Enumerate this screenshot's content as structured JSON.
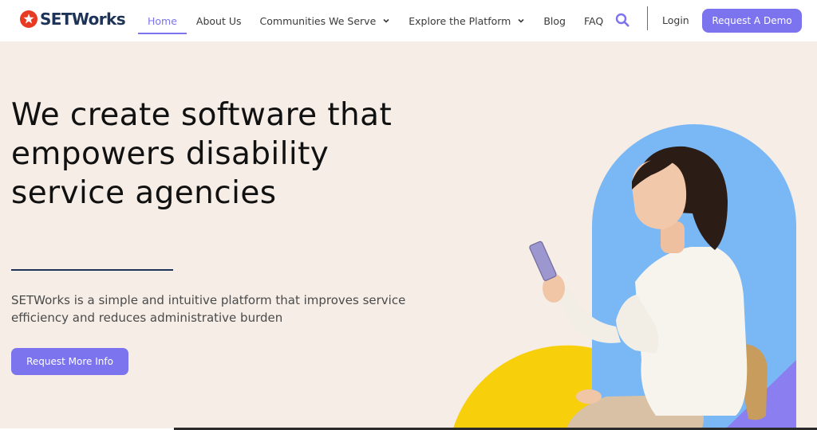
{
  "brand": {
    "name": "SETWorks",
    "logo_icon": "star-ring-logo",
    "navy": "#1d3357",
    "accent": "#7c74ef",
    "logo_red": "#e83a23"
  },
  "nav": {
    "items": [
      {
        "label": "Home",
        "active": true,
        "dropdown": false
      },
      {
        "label": "About Us",
        "active": false,
        "dropdown": false
      },
      {
        "label": "Communities We Serve",
        "active": false,
        "dropdown": true
      },
      {
        "label": "Explore the Platform",
        "active": false,
        "dropdown": true
      },
      {
        "label": "Blog",
        "active": false,
        "dropdown": false
      },
      {
        "label": "FAQ",
        "active": false,
        "dropdown": false
      }
    ],
    "search_icon": "search-icon",
    "login_label": "Login",
    "demo_label": "Request A Demo"
  },
  "hero": {
    "headline": "We create software that empowers disability service agencies",
    "subtext": "SETWorks is a simple and intuitive platform that improves service efficiency and reduces administrative burden",
    "cta_label": "Request More Info",
    "background": "#f5ede6",
    "arch_color": "#7ab8f5",
    "yellow_color": "#f7cf0b",
    "purple_color": "#8a7ef0"
  }
}
